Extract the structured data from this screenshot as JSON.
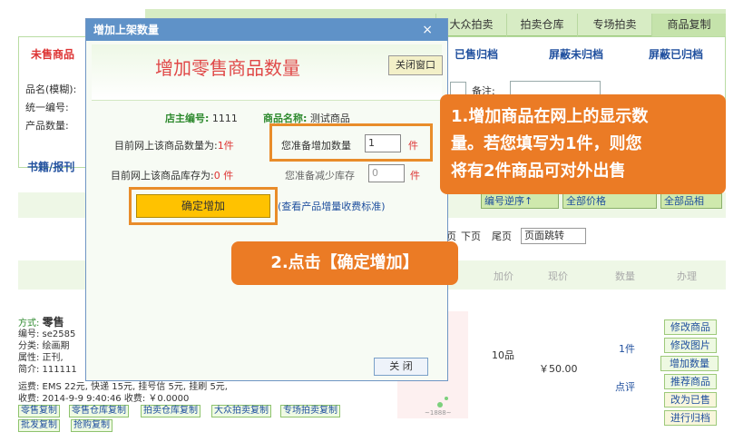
{
  "top_tabs": [
    "大众拍卖",
    "拍卖仓库",
    "专场拍卖",
    "商品复制"
  ],
  "sub_tabs": [
    "已售归档",
    "屏蔽未归档",
    "屏蔽已归档"
  ],
  "unsold_tab": "未售商品",
  "form_labels": [
    "品名(模糊):",
    "统一编号:",
    "产品数量:"
  ],
  "note_label": "备注:",
  "book_link": "书籍/报刊",
  "sort_selects": [
    "编号逆序↑",
    "全部价格",
    "全部品相"
  ],
  "pager": {
    "next": "下页",
    "last": "尾页",
    "prefix": "页",
    "jump": "页面跳转"
  },
  "table_headers": [
    "加价",
    "现价",
    "数量",
    "办理"
  ],
  "product": {
    "method_label": "方式:",
    "method_value": "零售",
    "code": "编号: se2585",
    "category": "分类: 绘画期",
    "attr": "属性: 正刊,",
    "intro": "简介: 111111",
    "shipping": "运费: EMS 22元, 快递 15元, 挂号信 5元, 挂刷 5元,",
    "received": "收费: 2014-9-9 9:40:46  收费: ￥0.0000",
    "grade": "10品",
    "price": "￥50.00",
    "qty": "1件",
    "review": "点评",
    "thumb_caption": "~1888~",
    "copy_buttons": [
      "零售复制",
      "零售仓库复制",
      "拍卖仓库复制",
      "大众拍卖复制",
      "专场拍卖复制",
      "批发复制",
      "抢购复制"
    ],
    "action_buttons": [
      "修改商品",
      "修改图片",
      "增加数量",
      "推荐商品",
      "改为已售",
      "进行归档"
    ]
  },
  "modal": {
    "title": "增加上架数量",
    "close": "×",
    "heading": "增加零售商品数量",
    "close_window": "关闭窗口",
    "shop_no_label": "店主编号:",
    "shop_no_value": "1111",
    "name_label": "商品名称:",
    "name_value": "测试商品",
    "cur_qty_label": "目前网上该商品数量为:",
    "cur_qty_value": "1件",
    "add_label": "您准备增加数量",
    "add_value": "1",
    "unit": "件",
    "stock_label": "目前网上该商品库存为:",
    "stock_value": "0 件",
    "reduce_label": "您准备减少库存",
    "reduce_value": "0",
    "confirm": "确定增加",
    "fee_link": "(查看产品增量收费标准)",
    "footer_close": "关 闭"
  },
  "callout1": [
    "1.增加商品在网上的显示数",
    "量。若您填写为1件，则您",
    "将有2件商品可对外出售"
  ],
  "callout2": "2.点击【确定增加】"
}
